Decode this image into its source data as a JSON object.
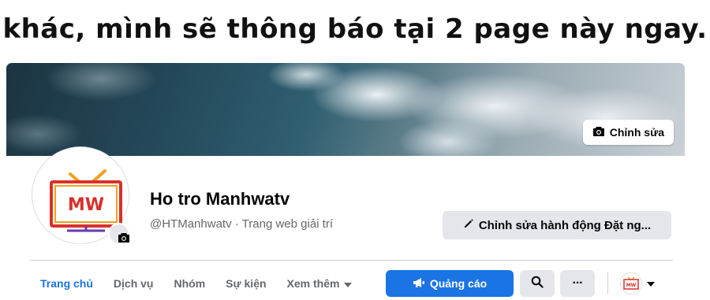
{
  "caption": "khác, mình sẽ thông báo tại 2 page này ngay.",
  "cover": {
    "edit_label": "Chỉnh sửa"
  },
  "page": {
    "name": "Ho tro Manhwatv",
    "username": "@HTManhwatv",
    "separator": "·",
    "category": "Trang web giải trí",
    "logo_text": "MW"
  },
  "actions": {
    "edit_action_label": "Chỉnh sửa hành động Đặt ng..."
  },
  "tabs": [
    {
      "label": "Trang chủ",
      "active": true
    },
    {
      "label": "Dịch vụ",
      "active": false
    },
    {
      "label": "Nhóm",
      "active": false
    },
    {
      "label": "Sự kiện",
      "active": false
    },
    {
      "label": "Xem thêm",
      "active": false
    }
  ],
  "toolbar": {
    "ads_label": "Quảng cáo",
    "more_label": "···"
  },
  "colors": {
    "accent": "#1b74e4",
    "logo_red": "#d9302a",
    "logo_orange": "#f2a01e",
    "logo_purple": "#6a3aa8"
  }
}
